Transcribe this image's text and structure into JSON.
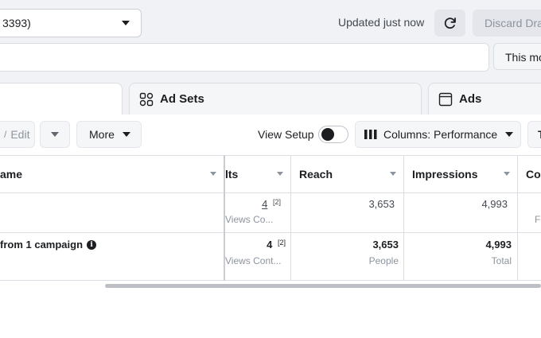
{
  "header": {
    "account_selector": "3393)",
    "updated_status": "Updated just now",
    "discard_label": "Discard Drafts",
    "date_range_label": "This month"
  },
  "tabs": [
    {
      "label": "Ad Sets"
    },
    {
      "label": "Ads"
    }
  ],
  "toolbar": {
    "edit_label": "Edit",
    "more_label": "More",
    "view_setup_label": "View Setup",
    "columns_label": "Columns: Performance",
    "view_setup_on": false
  },
  "table": {
    "columns": {
      "name": "ame",
      "results": "lts",
      "reach": "Reach",
      "impressions": "Impressions",
      "cost": "Cos"
    },
    "row": {
      "results": "4",
      "results_note": "[2]",
      "results_sub": "Views Co...",
      "reach": "3,653",
      "impressions": "4,993",
      "cost_sub": "F"
    },
    "summary": {
      "name": "from 1 campaign",
      "results": "4",
      "results_note": "[2]",
      "results_sub": "Views Cont...",
      "reach": "3,653",
      "reach_sub": "People",
      "impressions": "4,993",
      "impressions_sub": "Total"
    }
  }
}
